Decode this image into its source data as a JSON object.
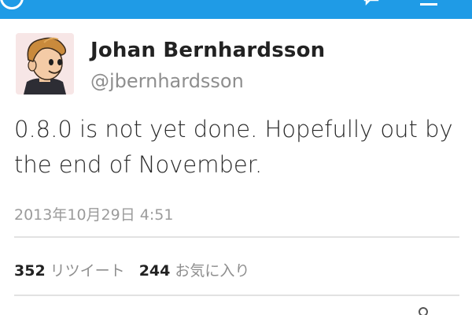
{
  "app_bar": {
    "color": "#1f9be6",
    "icons": [
      "back-circle-icon",
      "reply-icon",
      "menu-icon"
    ]
  },
  "tweet": {
    "author": {
      "display_name": "Johan Bernhardsson",
      "screen_name": "@jbernhardsson",
      "avatar_icon": "cartoon-avatar-icon"
    },
    "text_lines": [
      "0.8.0 is not yet done. Hopefully out by",
      "the end of November."
    ],
    "timestamp": "2013年10月29日 4:51",
    "stats": {
      "retweets": {
        "count": "352",
        "label": "リツイート"
      },
      "favorites": {
        "count": "244",
        "label": "お気に入り"
      }
    }
  }
}
